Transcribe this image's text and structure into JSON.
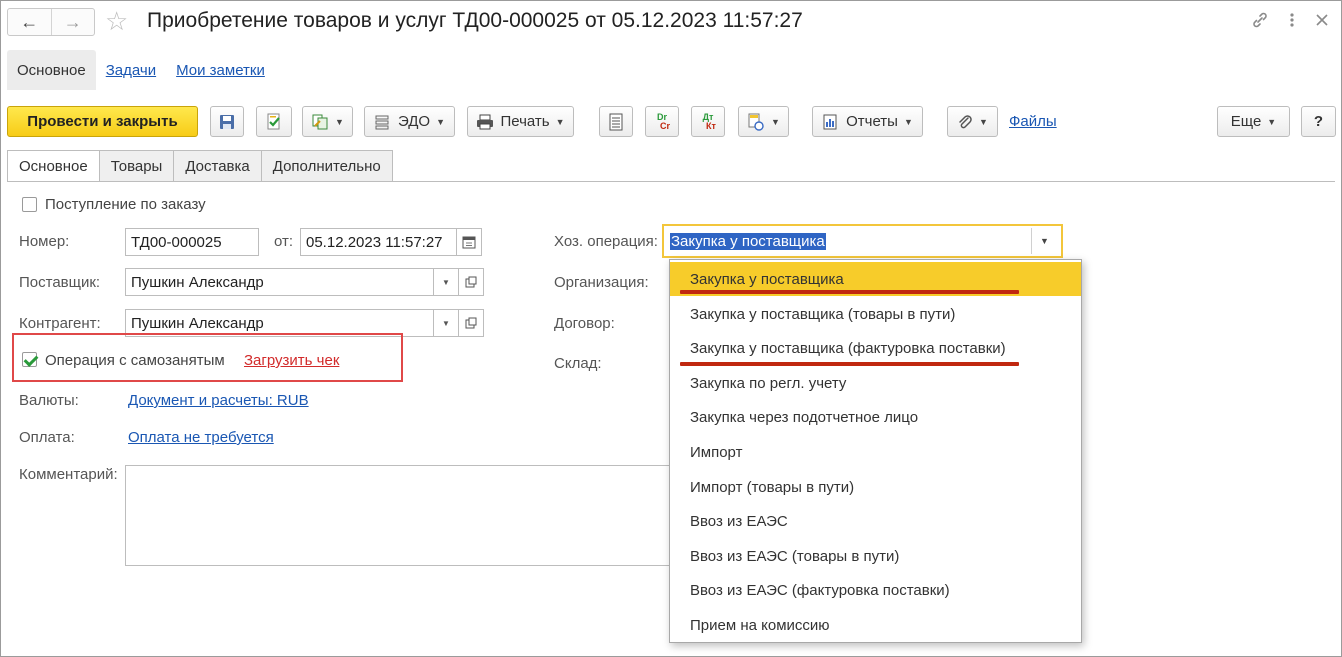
{
  "window": {
    "title": "Приобретение товаров и услуг ТД00-000025 от 05.12.2023 11:57:27",
    "back_glyph": "←",
    "forward_glyph": "→",
    "star_glyph": "☆"
  },
  "section_tabs": [
    {
      "label": "Основное"
    },
    {
      "label": "Задачи"
    },
    {
      "label": "Мои заметки"
    }
  ],
  "toolbar": {
    "post_close": "Провести и закрыть",
    "edo": "ЭДО",
    "print": "Печать",
    "reports": "Отчеты",
    "files": "Файлы",
    "more": "Еще",
    "help": "?",
    "dtkt_dt": "Dr",
    "dtkt_kt": "Cr",
    "dt_label": "Дт",
    "kt_label": "Кт"
  },
  "form_tabs": [
    {
      "label": "Основное"
    },
    {
      "label": "Товары"
    },
    {
      "label": "Доставка"
    },
    {
      "label": "Дополнительно"
    }
  ],
  "form": {
    "by_order_label": "Поступление по заказу",
    "number_label": "Номер:",
    "number_value": "ТД00-000025",
    "date_label": "от:",
    "date_value": "05.12.2023 11:57:27",
    "supplier_label": "Поставщик:",
    "supplier_value": "Пушкин Александр",
    "counterparty_label": "Контрагент:",
    "counterparty_value": "Пушкин Александр",
    "self_employed_label": "Операция с самозанятым",
    "load_receipt": "Загрузить чек",
    "currency_label": "Валюты:",
    "currency_link": "Документ и расчеты: RUB",
    "payment_label": "Оплата:",
    "payment_link": "Оплата не требуется",
    "comment_label": "Комментарий:",
    "operation_label": "Хоз. операция:",
    "operation_value": "Закупка у поставщика",
    "organization_label": "Организация:",
    "contract_label": "Договор:",
    "warehouse_label": "Склад:"
  },
  "dropdown": {
    "items": [
      {
        "label": "Закупка у поставщика"
      },
      {
        "label": "Закупка у поставщика (товары в пути)"
      },
      {
        "label": "Закупка у поставщика (фактуровка поставки)"
      },
      {
        "label": "Закупка по регл. учету"
      },
      {
        "label": "Закупка через подотчетное лицо"
      },
      {
        "label": "Импорт"
      },
      {
        "label": "Импорт (товары в пути)"
      },
      {
        "label": "Ввоз из ЕАЭС"
      },
      {
        "label": "Ввоз из ЕАЭС (товары в пути)"
      },
      {
        "label": "Ввоз из ЕАЭС (фактуровка поставки)"
      },
      {
        "label": "Прием на комиссию"
      }
    ],
    "selected_index": 0
  },
  "colors": {
    "accent_yellow": "#f7cc17",
    "link_blue": "#1a57b3",
    "highlight_red": "#e04848",
    "underline_red": "#c0280f",
    "selection_blue": "#2f65c4"
  },
  "icons": {
    "link": "link-icon",
    "kebab": "more-vert-icon",
    "close": "close-icon",
    "save": "save-icon",
    "post": "post-icon",
    "create_based": "create-based-icon",
    "edo": "edo-icon",
    "print": "printer-icon",
    "journal": "journal-icon",
    "dtkt": "dtkt-icon",
    "dt_kt": "dt-kt-icon",
    "structure": "doc-structure-icon",
    "reports": "reports-icon",
    "attach": "paperclip-icon",
    "calendar": "calendar-icon",
    "open": "open-icon"
  }
}
